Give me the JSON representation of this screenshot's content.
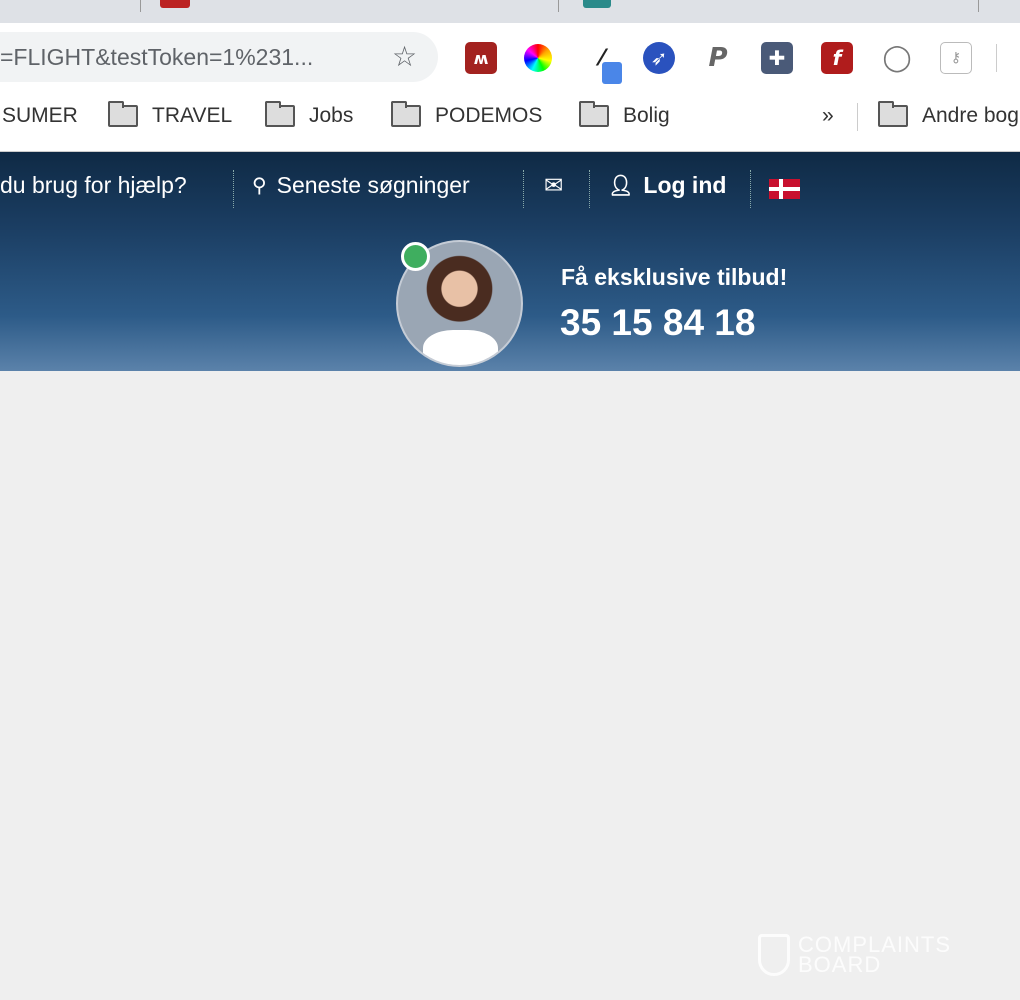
{
  "browser": {
    "url_text": "=FLIGHT&testToken=1%231...",
    "bookmarks": [
      "SUMER",
      "TRAVEL",
      "Jobs",
      "PODEMOS",
      "Bolig"
    ],
    "overflow_label": "»",
    "other_bookmarks": "Andre bog",
    "extensions": [
      "mendeley-icon",
      "color-wheel-icon",
      "eyedropper-icon",
      "rocket-icon",
      "paypal-icon",
      "puzzle-icon",
      "flash-icon",
      "circle-icon",
      "key-folder-icon"
    ]
  },
  "header": {
    "help": "du brug for hjælp?",
    "recent_searches": "Seneste søgninger",
    "login": "Log ind",
    "promo": "Få eksklusive tilbud!",
    "phone": "35 15 84 18"
  },
  "watermark": {
    "line1": "COMPLAINTS",
    "line2": "BOARD"
  },
  "colors": {
    "header": "#1b3e63",
    "online": "#3fae5f",
    "background": "#efefef"
  }
}
